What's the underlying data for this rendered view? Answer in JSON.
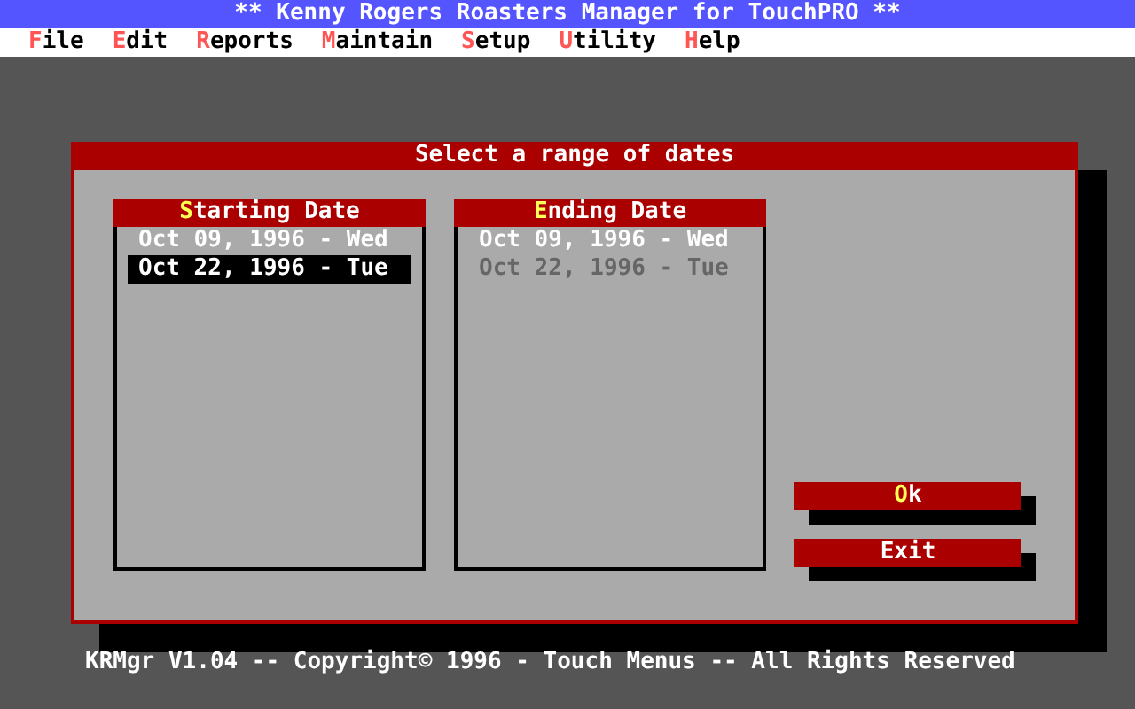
{
  "window": {
    "title": "** Kenny Rogers Roasters Manager for TouchPRO **"
  },
  "menu": [
    {
      "hotkey": "F",
      "rest": "ile"
    },
    {
      "hotkey": "E",
      "rest": "dit"
    },
    {
      "hotkey": "R",
      "rest": "eports"
    },
    {
      "hotkey": "M",
      "rest": "aintain"
    },
    {
      "hotkey": "S",
      "rest": "etup"
    },
    {
      "hotkey": "U",
      "rest": "tility"
    },
    {
      "hotkey": "H",
      "rest": "elp"
    }
  ],
  "dialog": {
    "title": "Select a range of dates",
    "lists": [
      {
        "hotkey": "S",
        "rest": "tarting Date",
        "items": [
          {
            "text": "Oct 09, 1996 - Wed",
            "selected": false,
            "disabled": false
          },
          {
            "text": "Oct 22, 1996 - Tue",
            "selected": true,
            "disabled": false
          }
        ]
      },
      {
        "hotkey": "E",
        "rest": "nding Date",
        "items": [
          {
            "text": "Oct 09, 1996 - Wed",
            "selected": false,
            "disabled": false
          },
          {
            "text": "Oct 22, 1996 - Tue",
            "selected": false,
            "disabled": true
          }
        ]
      }
    ],
    "buttons": [
      {
        "hotkey": "O",
        "rest": "k"
      },
      {
        "rest": "Exit"
      }
    ]
  },
  "status_bar": "KRMgr V1.04 -- Copyright© 1996 - Touch Menus -- All Rights Reserved"
}
